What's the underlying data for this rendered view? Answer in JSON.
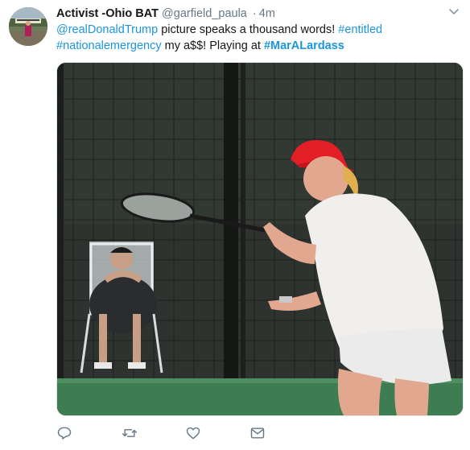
{
  "tweet": {
    "display_name": "Activist -Ohio BAT",
    "handle": "@garfield_paula",
    "separator": "·",
    "time": "4m",
    "body": {
      "mention": "@realDonaldTrump",
      "text1": " picture speaks a thousand words! ",
      "hashtag1": "#entitled",
      "hashtag2": "#nationalemergency",
      "text2": " my a$$! Playing at ",
      "hashtag3": "#MarALardass"
    }
  },
  "icons": {
    "avatar": "profile-photo",
    "caret": "chevron-down-icon",
    "reply": "reply-icon",
    "retweet": "retweet-icon",
    "like": "heart-icon",
    "dm": "envelope-icon"
  },
  "colors": {
    "link": "#1b95e0",
    "text": "#14171a",
    "muted": "#657786",
    "icon": "#657786"
  }
}
